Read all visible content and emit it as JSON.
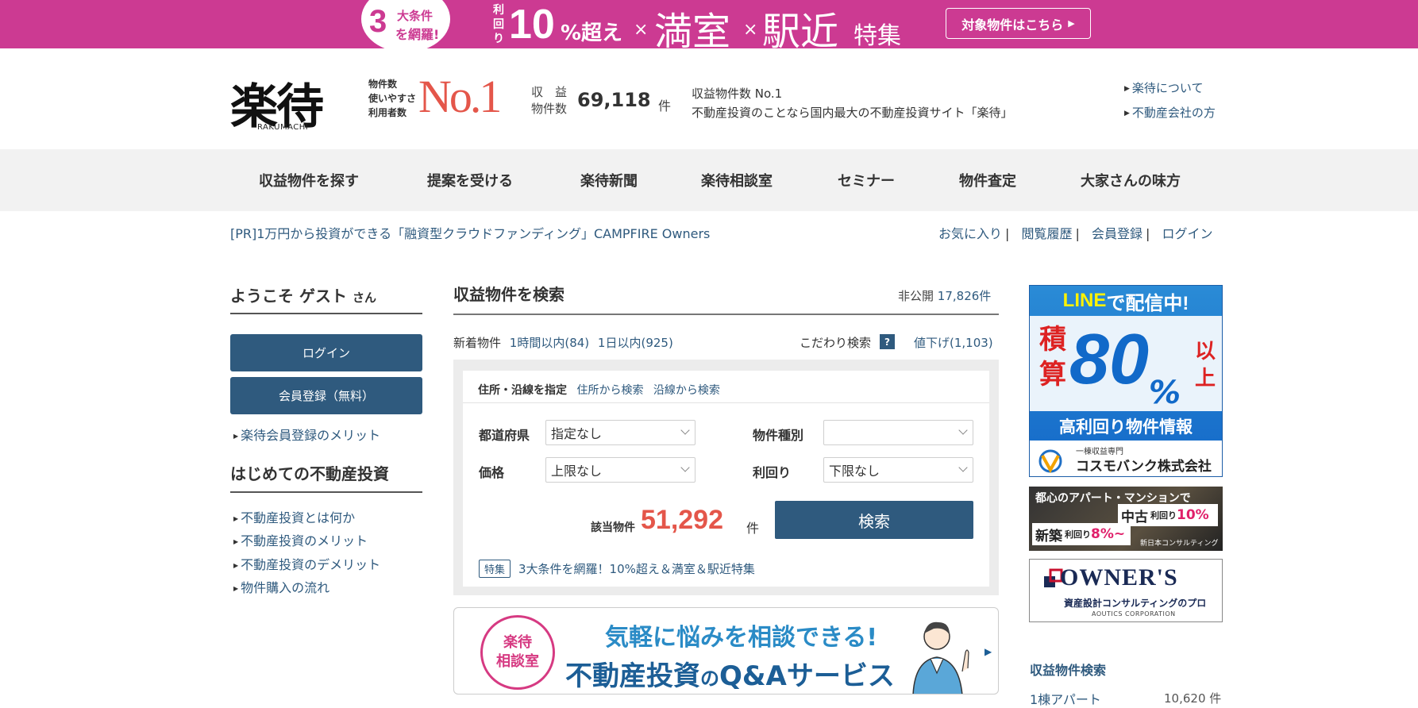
{
  "banner": {
    "circle_num": "3",
    "circle_line1": "大条件",
    "circle_line2": "を網羅!",
    "riri": "利回り",
    "ten": "10",
    "pct": "%超え",
    "times": "×",
    "full": "満室",
    "station": "駅近",
    "feature": "特集",
    "button": "対象物件はこちら"
  },
  "header": {
    "logo": "楽待",
    "logo_sub": "RAKUMACHI",
    "no1_lines": [
      "物件数",
      "使いやすさ",
      "利用者数"
    ],
    "no1": "No.1",
    "count_label1": "収　益",
    "count_label2": "物件数",
    "count": "69,118",
    "count_unit": "件",
    "desc1": "収益物件数 No.1",
    "desc2": "不動産投資のことなら国内最大の不動産投資サイト「楽待」",
    "links": [
      "楽待について",
      "不動産会社の方"
    ]
  },
  "nav": [
    "収益物件を探す",
    "提案を受ける",
    "楽待新聞",
    "楽待相談室",
    "セミナー",
    "物件査定",
    "大家さんの味方"
  ],
  "pr": "[PR]1万円から投資ができる「融資型クラウドファンディング」CAMPFIRE Owners",
  "user_links": [
    "お気に入り",
    "閲覧履歴",
    "会員登録",
    "ログイン"
  ],
  "sidebar": {
    "welcome": "ようこそ ゲスト",
    "san": "さん",
    "login": "ログイン",
    "register": "会員登録（無料）",
    "merit": "楽待会員登録のメリット",
    "beginner_title": "はじめての不動産投資",
    "beginner_links": [
      "不動産投資とは何か",
      "不動産投資のメリット",
      "不動産投資のデメリット",
      "物件購入の流れ"
    ]
  },
  "search": {
    "title": "収益物件を検索",
    "hidden_label": "非公開",
    "hidden_count": "17,826件",
    "new_label": "新着物件",
    "new_1h": "1時間以内(84)",
    "new_1d": "1日以内(925)",
    "kodawari": "こだわり検索",
    "help": "?",
    "price_down": "値下げ(1,103)",
    "tab_active": "住所・沿線を指定",
    "tab_address": "住所から検索",
    "tab_line": "沿線から検索",
    "pref_label": "都道府県",
    "pref_value": "指定なし",
    "type_label": "物件種別",
    "type_value": "",
    "price_label": "価格",
    "price_value": "上限なし",
    "yield_label": "利回り",
    "yield_value": "下限なし",
    "hit_label": "該当物件",
    "hit_count": "51,292",
    "hit_unit": "件",
    "search_button": "検索",
    "tag": "特集",
    "tag_text": "3大条件を網羅！10%超え＆満室＆駅近特集"
  },
  "qa": {
    "badge1": "楽待",
    "badge2": "相談室",
    "line1": "気軽に悩みを相談できる!",
    "line2a": "不動産投資",
    "line2b": "の",
    "line2c": "Q&Aサービス"
  },
  "ads": {
    "ad1_top_a": "LINE",
    "ad1_top_b": "で配信中!",
    "ad1_seki": "積算",
    "ad1_num": "80",
    "ad1_pct": "%",
    "ad1_ijo": "以上",
    "ad1_hi": "高利回り物件情報",
    "ad1_s1": "一棟収益専門",
    "ad1_s2": "コスモバンク株式会社",
    "ad2_t1": "都心のアパート・マンションで",
    "ad2_new": "新築",
    "ad2_new_s": "利回り",
    "ad2_new_v": "8%~",
    "ad2_old": "中古",
    "ad2_old_s": "利回り",
    "ad2_old_v": "10%",
    "ad2_logo": "新日本コンサルティング",
    "ad3_t": "OWNER'S",
    "ad3_s": "資産設計コンサルティングのプロ",
    "ad3_c": "AOUTICS CORPORATION"
  },
  "right": {
    "title": "収益物件検索",
    "item": "1棟アパート",
    "count": "10,620 件"
  }
}
